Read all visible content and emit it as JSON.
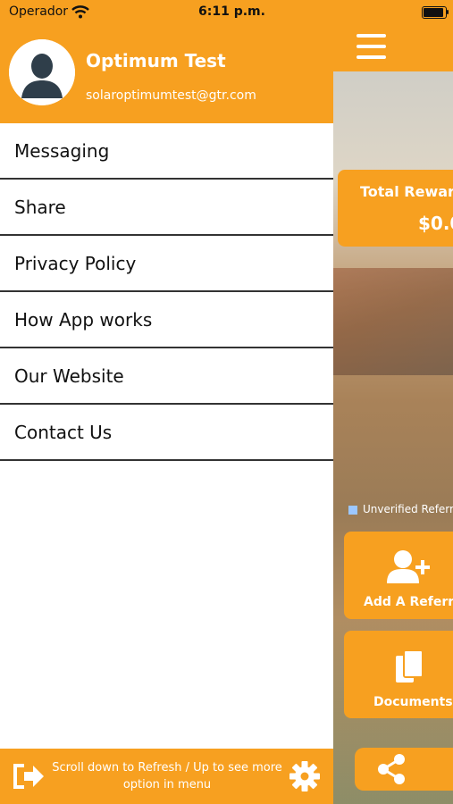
{
  "status_bar": {
    "carrier": "Operador",
    "time": "6:11 p.m."
  },
  "drawer": {
    "user": {
      "name": "Optimum Test",
      "email": "solaroptimumtest@gtr.com"
    },
    "menu": [
      {
        "label": "Messaging"
      },
      {
        "label": "Share"
      },
      {
        "label": "Privacy Policy"
      },
      {
        "label": "How App works"
      },
      {
        "label": "Our Website"
      },
      {
        "label": "Contact Us"
      }
    ],
    "footer": {
      "hint_line1": "Scroll down to Refresh / Up to see more",
      "hint_line2": "option in menu",
      "logout_icon": "logout-icon",
      "settings_icon": "gear-icon"
    }
  },
  "main": {
    "reward_title": "Total Rewar",
    "reward_value": "$0.0",
    "legend_label": "Unverified Referr",
    "tiles": [
      {
        "label": "Add A Referra",
        "icon": "add-user-icon"
      },
      {
        "label": "Documents",
        "icon": "documents-icon"
      }
    ],
    "share_icon": "share-icon"
  },
  "colors": {
    "accent": "#f7a020",
    "divider": "#333333",
    "text": "#111111"
  }
}
